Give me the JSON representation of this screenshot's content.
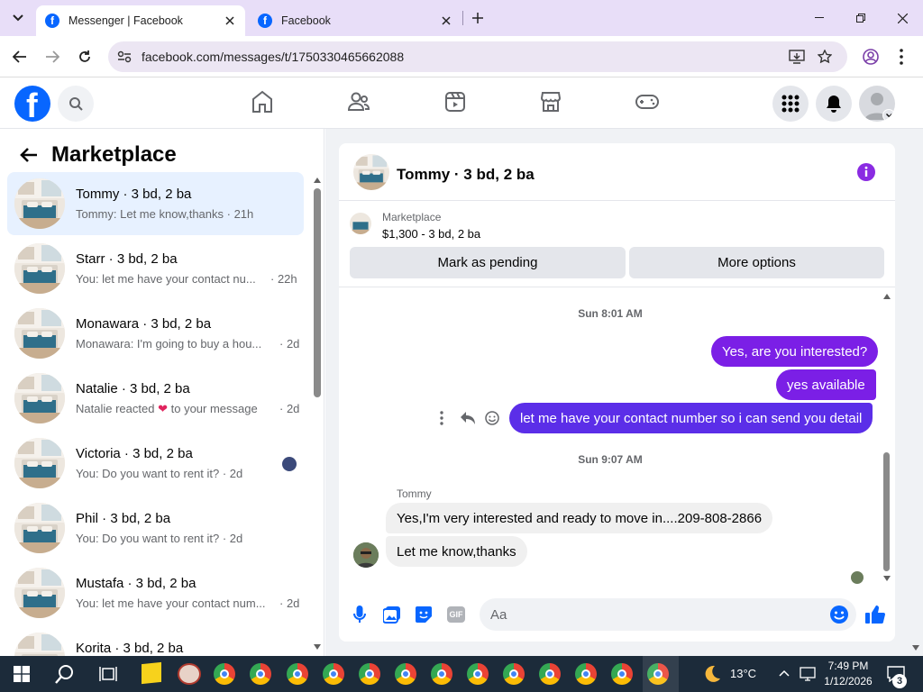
{
  "browser": {
    "tabs": [
      {
        "title": "Messenger | Facebook"
      },
      {
        "title": "Facebook"
      }
    ],
    "url": "facebook.com/messages/t/1750330465662088"
  },
  "sidebar": {
    "title": "Marketplace",
    "conversations": [
      {
        "name": "Tommy · 3 bd, 2 ba",
        "preview": "Tommy: Let me know,thanks · 21h",
        "time": ""
      },
      {
        "name": "Starr · 3 bd, 2 ba",
        "preview": "You: let me have your contact nu...",
        "time": "· 22h"
      },
      {
        "name": "Monawara · 3 bd, 2 ba",
        "preview": "Monawara: I'm going to buy a hou...",
        "time": "· 2d"
      },
      {
        "name": "Natalie · 3 bd, 2 ba",
        "preview": "Natalie reacted",
        "preview2": "to your message",
        "time": "· 2d"
      },
      {
        "name": "Victoria · 3 bd, 2 ba",
        "preview": "You: Do you want to rent it? · 2d",
        "time": ""
      },
      {
        "name": "Phil · 3 bd, 2 ba",
        "preview": "You: Do you want to rent it? · 2d",
        "time": ""
      },
      {
        "name": "Mustafa · 3 bd, 2 ba",
        "preview": "You: let me have your contact num...",
        "time": "· 2d"
      },
      {
        "name": "Korita · 3 bd, 2 ba",
        "preview": "",
        "time": ""
      }
    ]
  },
  "chat": {
    "title": "Tommy · 3 bd, 2 ba",
    "listing": {
      "source": "Marketplace",
      "summary": "$1,300 - 3 bd, 2 ba"
    },
    "mark_pending_label": "Mark as pending",
    "more_options_label": "More options",
    "timestamp1": "Sun 8:01 AM",
    "timestamp2": "Sun 9:07 AM",
    "sender_name": "Tommy",
    "messages_out": [
      "Yes, are you interested?",
      "yes available",
      "let me have your contact number so i can send you detail"
    ],
    "messages_in": [
      "Yes,I'm very interested and ready to move in....209-808-2866",
      "Let me know,thanks"
    ],
    "composer_placeholder": "Aa"
  },
  "taskbar": {
    "temperature": "13°C",
    "time": "7:49 PM",
    "date": "1/12/2026",
    "notifications": "3"
  },
  "colors": {
    "brand": "#0866ff",
    "outgoing_bubble": "#7b1fe6",
    "accent_icon": "#8a2be2"
  }
}
